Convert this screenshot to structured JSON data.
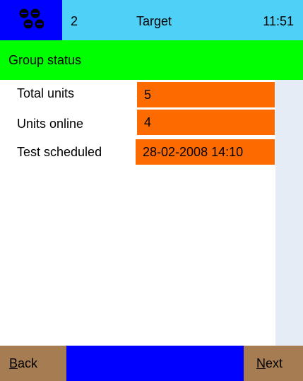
{
  "status_bar": {
    "count": "2",
    "title": "Target",
    "time": "11:51",
    "logo_icon": "group-nodes-icon"
  },
  "section": {
    "title": "Group status"
  },
  "rows": [
    {
      "label": "Total units",
      "value": "5"
    },
    {
      "label": "Units online",
      "value": "4"
    },
    {
      "label": "Test scheduled",
      "value": "28-02-2008 14:10"
    }
  ],
  "footer": {
    "back_label": "Back",
    "next_label": "Next"
  },
  "colors": {
    "status_bar": "#4fd0f7",
    "logo_bg": "#0000fe",
    "section_bar": "#00ff00",
    "value_bg": "#fd6a00",
    "button_bg": "#a67c52",
    "scroll_track": "#e6ecf5"
  }
}
